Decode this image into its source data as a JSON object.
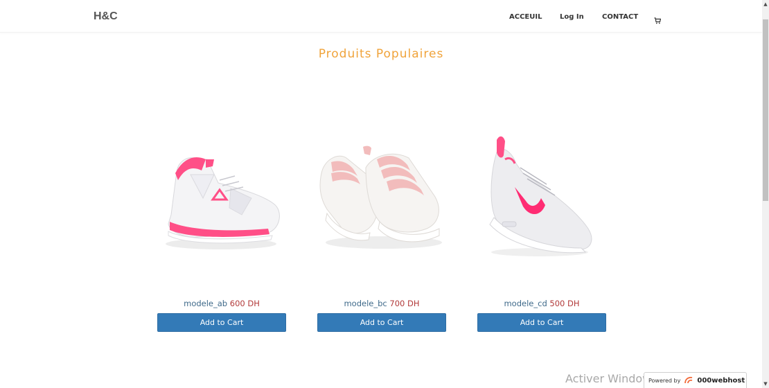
{
  "navbar": {
    "brand": "H&C",
    "links": [
      {
        "label": "ACCEUIL"
      },
      {
        "label": "Log In"
      },
      {
        "label": "CONTACT"
      }
    ],
    "cart_icon": "cart-icon"
  },
  "section": {
    "title": "Produits Populaires"
  },
  "products": [
    {
      "name": "modele_ab",
      "price": "600 DH",
      "button": "Add to Cart",
      "image": "white-pink-high-top-sneaker"
    },
    {
      "name": "modele_bc",
      "price": "700 DH",
      "button": "Add to Cart",
      "image": "white-pink-strap-sneakers"
    },
    {
      "name": "modele_cd",
      "price": "500 DH",
      "button": "Add to Cart",
      "image": "grey-pink-running-shoe"
    }
  ],
  "overlay": {
    "watermark": "Activer Windows",
    "badge_prefix": "Powered by",
    "badge_brand": "000webhost"
  },
  "colors": {
    "title": "#f0a33a",
    "button": "#337ab7",
    "name": "#3f6a8a",
    "price": "#b23a3a"
  }
}
